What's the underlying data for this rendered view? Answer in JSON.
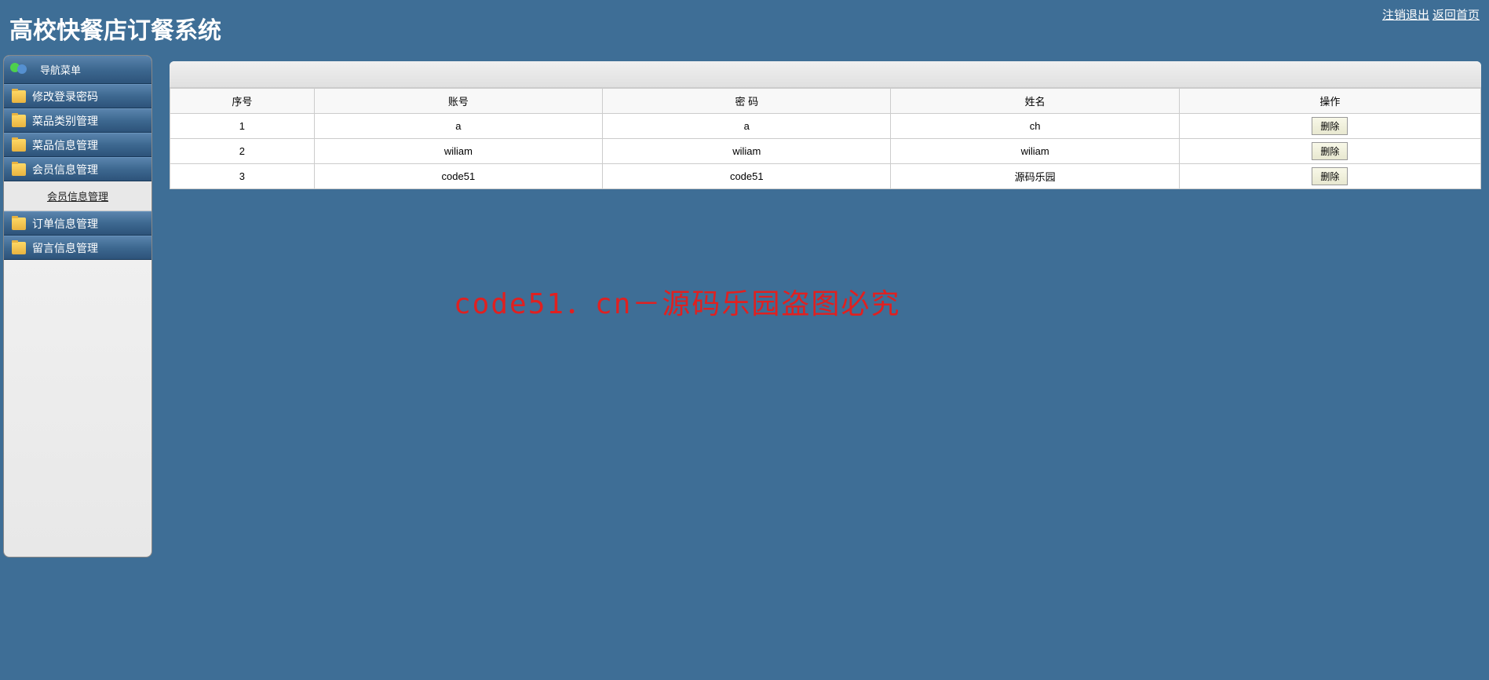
{
  "header": {
    "title": "高校快餐店订餐系统",
    "logout_link": "注销退出",
    "home_link": "返回首页"
  },
  "sidebar": {
    "nav_header": "导航菜单",
    "items": [
      {
        "label": "修改登录密码"
      },
      {
        "label": "菜品类别管理"
      },
      {
        "label": "菜品信息管理"
      },
      {
        "label": "会员信息管理"
      },
      {
        "label": "订单信息管理"
      },
      {
        "label": "留言信息管理"
      }
    ],
    "submenu_label": "会员信息管理"
  },
  "table": {
    "headers": {
      "seq": "序号",
      "account": "账号",
      "password": "密 码",
      "name": "姓名",
      "action": "操作"
    },
    "rows": [
      {
        "seq": "1",
        "account": "a",
        "password": "a",
        "name": "ch"
      },
      {
        "seq": "2",
        "account": "wiliam",
        "password": "wiliam",
        "name": "wiliam"
      },
      {
        "seq": "3",
        "account": "code51",
        "password": "code51",
        "name": "源码乐园"
      }
    ],
    "delete_label": "删除"
  },
  "watermark_text": "code51．cn－源码乐园盗图必究"
}
